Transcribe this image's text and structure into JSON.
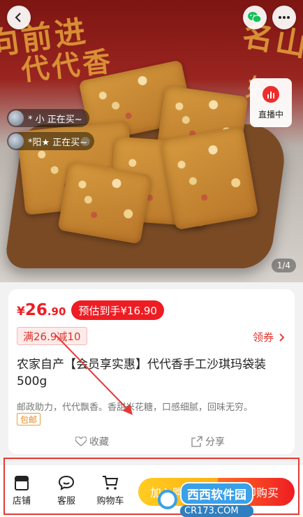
{
  "gallery": {
    "counter": "1/4",
    "live_label": "直播中",
    "buyers": [
      {
        "text": "* 小 正在买~"
      },
      {
        "text": "*阳★ 正在买~"
      }
    ],
    "banner": {
      "left_top": "向前进",
      "left_bottom": "代代香",
      "right_top": "名山",
      "right_bottom": "好"
    }
  },
  "product": {
    "price": {
      "currency": "¥",
      "integer": "26",
      "decimal": ".90"
    },
    "estimated": "预估到手¥16.90",
    "coupon": "满26.9减10",
    "get_coupon": "领券",
    "title": "农家自产【会员享实惠】代代香手工沙琪玛袋装500g",
    "description": "邮政助力，代代飘香。香甜米花糖，口感细腻，回味无穷。",
    "tag": "包邮",
    "favorite": "收藏",
    "share": "分享"
  },
  "bottom_bar": {
    "store": "店铺",
    "service": "客服",
    "cart": "购物车",
    "add_to_cart": "加入购物车",
    "buy_now": "立即购买"
  },
  "watermark": {
    "name": "西西软件园",
    "url": "CR173.COM"
  },
  "colors": {
    "accent": "#ee1d23",
    "yellow": "#ffb011",
    "orange": "#ff6b22"
  }
}
